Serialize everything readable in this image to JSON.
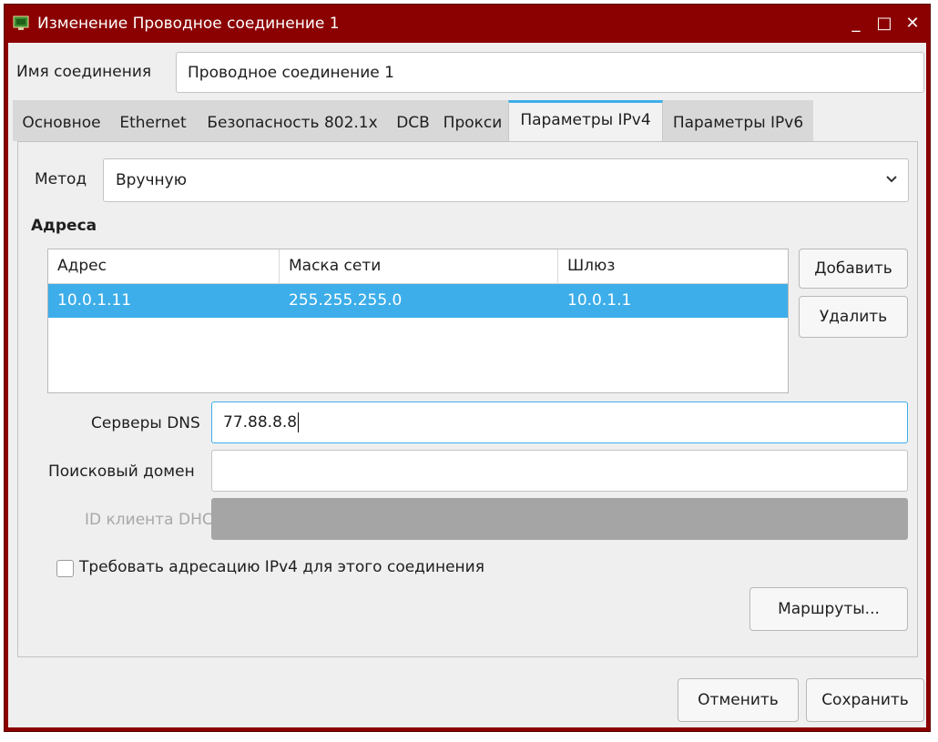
{
  "window": {
    "title": "Изменение Проводное соединение 1",
    "minimize_glyph": "_",
    "maximize_glyph": "□",
    "close_glyph": "✕",
    "titlebar_color": "#8b0000"
  },
  "connection": {
    "name_label": "Имя соединения",
    "name_value": "Проводное соединение 1"
  },
  "tabs": [
    {
      "label": "Основное"
    },
    {
      "label": "Ethernet"
    },
    {
      "label": "Безопасность 802.1x"
    },
    {
      "label": "DCB"
    },
    {
      "label": "Прокси"
    },
    {
      "label": "Параметры IPv4"
    },
    {
      "label": "Параметры IPv6"
    }
  ],
  "ipv4": {
    "method_label": "Метод",
    "method_value": "Вручную",
    "addresses_title": "Адреса",
    "columns": [
      "Адрес",
      "Маска сети",
      "Шлюз"
    ],
    "rows": [
      {
        "address": "10.0.1.11",
        "netmask": "255.255.255.0",
        "gateway": "10.0.1.1"
      }
    ],
    "add_button": "Добавить",
    "delete_button": "Удалить",
    "dns_label": "Серверы DNS",
    "dns_value": "77.88.8.8",
    "search_domain_label": "Поисковый домен",
    "search_domain_value": "",
    "dhcp_client_id_label": "ID клиента DHCP",
    "require_ipv4_label": "Требовать адресацию IPv4 для этого соединения",
    "routes_button": "Маршруты..."
  },
  "footer": {
    "cancel_button": "Отменить",
    "save_button": "Сохранить"
  },
  "colors": {
    "accent": "#3daee9",
    "selection_text": "#ffffff"
  }
}
